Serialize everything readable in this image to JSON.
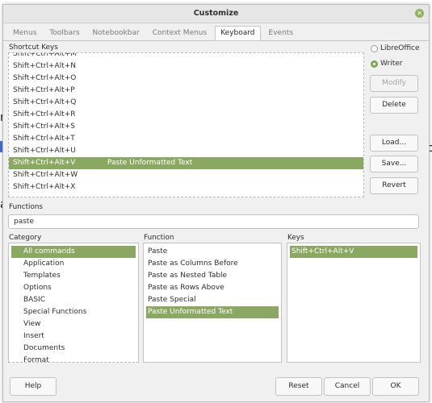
{
  "background": {
    "left_text_1": "n",
    "left_text_3": "a",
    "right_text": "c"
  },
  "dialog": {
    "title": "Customize",
    "tabs": [
      "Menus",
      "Toolbars",
      "Notebookbar",
      "Context Menus",
      "Keyboard",
      "Events"
    ],
    "active_tab": "Keyboard",
    "shortcut_keys_label": "Shortcut Keys",
    "shortcut_rows": [
      {
        "key": "Shift+Ctrl+Alt+M",
        "function": ""
      },
      {
        "key": "Shift+Ctrl+Alt+N",
        "function": ""
      },
      {
        "key": "Shift+Ctrl+Alt+O",
        "function": ""
      },
      {
        "key": "Shift+Ctrl+Alt+P",
        "function": ""
      },
      {
        "key": "Shift+Ctrl+Alt+Q",
        "function": ""
      },
      {
        "key": "Shift+Ctrl+Alt+R",
        "function": ""
      },
      {
        "key": "Shift+Ctrl+Alt+S",
        "function": ""
      },
      {
        "key": "Shift+Ctrl+Alt+T",
        "function": ""
      },
      {
        "key": "Shift+Ctrl+Alt+U",
        "function": ""
      },
      {
        "key": "Shift+Ctrl+Alt+V",
        "function": "Paste Unformatted Text"
      },
      {
        "key": "Shift+Ctrl+Alt+W",
        "function": ""
      },
      {
        "key": "Shift+Ctrl+Alt+X",
        "function": ""
      }
    ],
    "selected_shortcut": "Shift+Ctrl+Alt+V",
    "radio_libreoffice": "LibreOffice",
    "radio_writer": "Writer",
    "selected_scope": "Writer",
    "buttons": {
      "modify": "Modify",
      "delete": "Delete",
      "load": "Load...",
      "save": "Save...",
      "revert": "Revert",
      "help": "Help",
      "reset": "Reset",
      "cancel": "Cancel",
      "ok": "OK"
    },
    "functions_label": "Functions",
    "search_value": "paste",
    "category_label": "Category",
    "function_label": "Function",
    "keys_label": "Keys",
    "categories": [
      "All commands",
      "Application",
      "Templates",
      "Options",
      "BASIC",
      "Special Functions",
      "View",
      "Insert",
      "Documents",
      "Format"
    ],
    "selected_category": "All commands",
    "functions": [
      "Paste",
      "Paste as Columns Before",
      "Paste as Nested Table",
      "Paste as Rows Above",
      "Paste Special",
      "Paste Unformatted Text"
    ],
    "selected_function": "Paste Unformatted Text",
    "keys": [
      "Shift+Ctrl+Alt+V"
    ],
    "selected_key": "Shift+Ctrl+Alt+V"
  },
  "colors": {
    "accent": "#8aa862",
    "dialog_bg": "#f0f0f0"
  },
  "icons": {
    "close": "close-icon"
  }
}
